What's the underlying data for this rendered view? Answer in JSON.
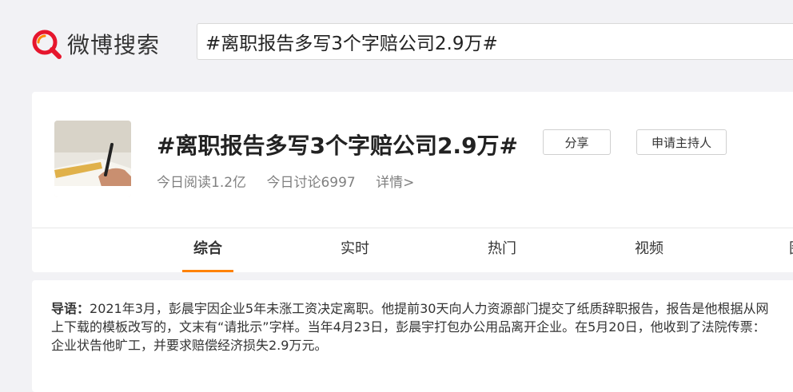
{
  "header": {
    "logo_text": "微博搜索",
    "logo_icon": "search-magnifier-icon",
    "search_query": "#离职报告多写3个字赔公司2.9万#"
  },
  "topic": {
    "title": "#离职报告多写3个字赔公司2.9万#",
    "read_count": "今日阅读1.2亿",
    "discuss_count": "今日讨论6997",
    "detail_link": "详情>",
    "share_label": "分享",
    "host_label": "申请主持人"
  },
  "tabs": [
    {
      "label": "综合",
      "active": true
    },
    {
      "label": "实时",
      "active": false
    },
    {
      "label": "热门",
      "active": false
    },
    {
      "label": "视频",
      "active": false
    },
    {
      "label": "图",
      "active": false
    }
  ],
  "lead": {
    "label": "导语：",
    "text": "2021年3月，彭晨宇因企业5年未涨工资决定离职。他提前30天向人力资源部门提交了纸质辞职报告，报告是他根据从网上下载的模板改写的，文末有“请批示”字样。当年4月23日，彭晨宇打包办公用品离开企业。在5月20日，他收到了法院传票：企业状告他旷工，并要求赔偿经济损失2.9万元。"
  },
  "colors": {
    "accent": "#ff8200",
    "logo_red": "#e6162d",
    "page_bg": "#f2f2f5"
  }
}
